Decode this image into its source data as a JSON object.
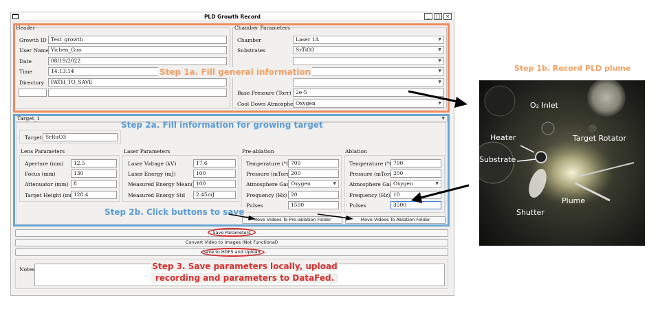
{
  "window": {
    "title": "PLD Growth Record",
    "controls": [
      "_",
      "□",
      "×"
    ]
  },
  "header": {
    "group_title": "Header",
    "fields": [
      {
        "label": "Growth ID",
        "value": "Test_growth"
      },
      {
        "label": "User Name",
        "value": "Yichen_Guo"
      },
      {
        "label": "Date",
        "value": "08/19/2022"
      },
      {
        "label": "Time",
        "value": "14:13:14"
      },
      {
        "label": "Directory",
        "value": "PATH_TO_SAVE"
      }
    ],
    "extra_key": "",
    "extra_value": ""
  },
  "chamber": {
    "group_title": "Chamber Parameters",
    "chamber_label": "Chamber",
    "chamber_value": "Laser 1A",
    "substrates_label": "Substrates",
    "substrates_value": "SrTiO3",
    "base_pressure_label": "Base Pressure (Torr)",
    "base_pressure_value": "2e-5",
    "cool_down_label": "Cool Down Atmosphere",
    "cool_down_value": "Oxygen"
  },
  "target": {
    "tab": "Target_1",
    "target_label": "Target:",
    "target_value": "SrRuO3",
    "lens": {
      "title": "Lens Parameters",
      "fields": [
        {
          "label": "Aperture (mm)",
          "value": "12.5"
        },
        {
          "label": "Focus (mm)",
          "value": "130"
        },
        {
          "label": "Attenuator (mm)",
          "value": "8"
        },
        {
          "label": "Target Height (mm)",
          "value": "128.4"
        }
      ]
    },
    "laser": {
      "title": "Laser Parameters",
      "fields": [
        {
          "label": "Laser Voltage (kV)",
          "value": "17.6"
        },
        {
          "label": "Laser Energy (mJ)",
          "value": "100"
        },
        {
          "label": "Measured Energy Mean(mJ)",
          "value": "100"
        },
        {
          "label": "Measured Energy Std",
          "value": "2.45mJ"
        }
      ]
    },
    "preablation": {
      "title": "Pre-ablation",
      "fields": [
        {
          "label": "Temperature (°C)",
          "value": "700"
        },
        {
          "label": "Pressure (mTorr)",
          "value": "200"
        },
        {
          "label": "Atmosphere Gas",
          "value": "Oxygen"
        },
        {
          "label": "Frequency (Hz)",
          "value": "20"
        },
        {
          "label": "Pulses",
          "value": "1500"
        }
      ],
      "button": "Move Videos To Pre-ablation Folder"
    },
    "ablation": {
      "title": "Ablation",
      "fields": [
        {
          "label": "Temperature (°C)",
          "value": "700"
        },
        {
          "label": "Pressure (mTorr)",
          "value": "200"
        },
        {
          "label": "Atmosphere Gas",
          "value": "Oxygen"
        },
        {
          "label": "Frequency (Hz)",
          "value": "10"
        },
        {
          "label": "Pulses",
          "value": "3500"
        }
      ],
      "button": "Move Videos To Ablation Folder"
    }
  },
  "actions": {
    "save_parameters": "Save Parameters",
    "convert_video": "Convert Video to Images (Not Functional)",
    "save_hdf5": "Save to HDF5 and Upload"
  },
  "notes": {
    "label": "Notes",
    "value": ""
  },
  "annotations": {
    "step1a": "Step 1a. Fill general information",
    "step1b": "Step 1b. Record PLD plume",
    "step2a": "Step 2a. Fill information for growing target",
    "step2b": "Step 2b. Click buttons to save",
    "step3_line1": "Step 3. Save parameters locally, upload",
    "step3_line2": "recording and parameters to DataFed."
  },
  "photo_labels": {
    "o2_inlet": "O₂ Inlet",
    "heater": "Heater",
    "target_rotator": "Target Rotator",
    "substrate": "Substrate",
    "plume": "Plume",
    "shutter": "Shutter"
  },
  "colors": {
    "orange": "#ef8a5d",
    "blue": "#6aa5d3",
    "red": "#d62f2f",
    "annotation_orange": "#f0a066",
    "annotation_blue": "#5b9bd5"
  }
}
